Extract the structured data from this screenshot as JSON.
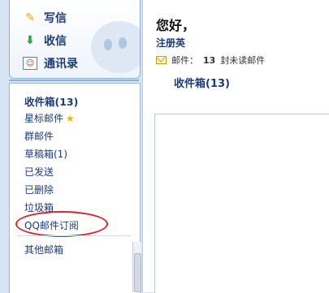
{
  "actions": {
    "write": {
      "label": "写信",
      "icon": "pencil-icon"
    },
    "inbox": {
      "label": "收信",
      "icon": "download-icon"
    },
    "contacts": {
      "label": "通讯录",
      "icon": "contacts-icon"
    }
  },
  "folders": [
    {
      "label": "收件箱(13)",
      "bold": true
    },
    {
      "label": "星标邮件",
      "icon": "star-icon"
    },
    {
      "label": "群邮件"
    },
    {
      "label": "草稿箱(1)"
    },
    {
      "label": "已发送"
    },
    {
      "label": "已删除"
    },
    {
      "label": "垃圾箱"
    },
    {
      "label": "QQ邮件订阅",
      "highlighted": true
    },
    {
      "label": "其他邮箱"
    }
  ],
  "main": {
    "greeting": "您好，",
    "register_text": "注册英",
    "unread_prefix": "邮件：",
    "unread_count": "13",
    "unread_suffix": "封未读邮件",
    "inbox_link": "收件箱(13)"
  },
  "colors": {
    "link": "#1d3c78",
    "highlight_circle": "#d3262f",
    "background": "#d7e4f3"
  }
}
